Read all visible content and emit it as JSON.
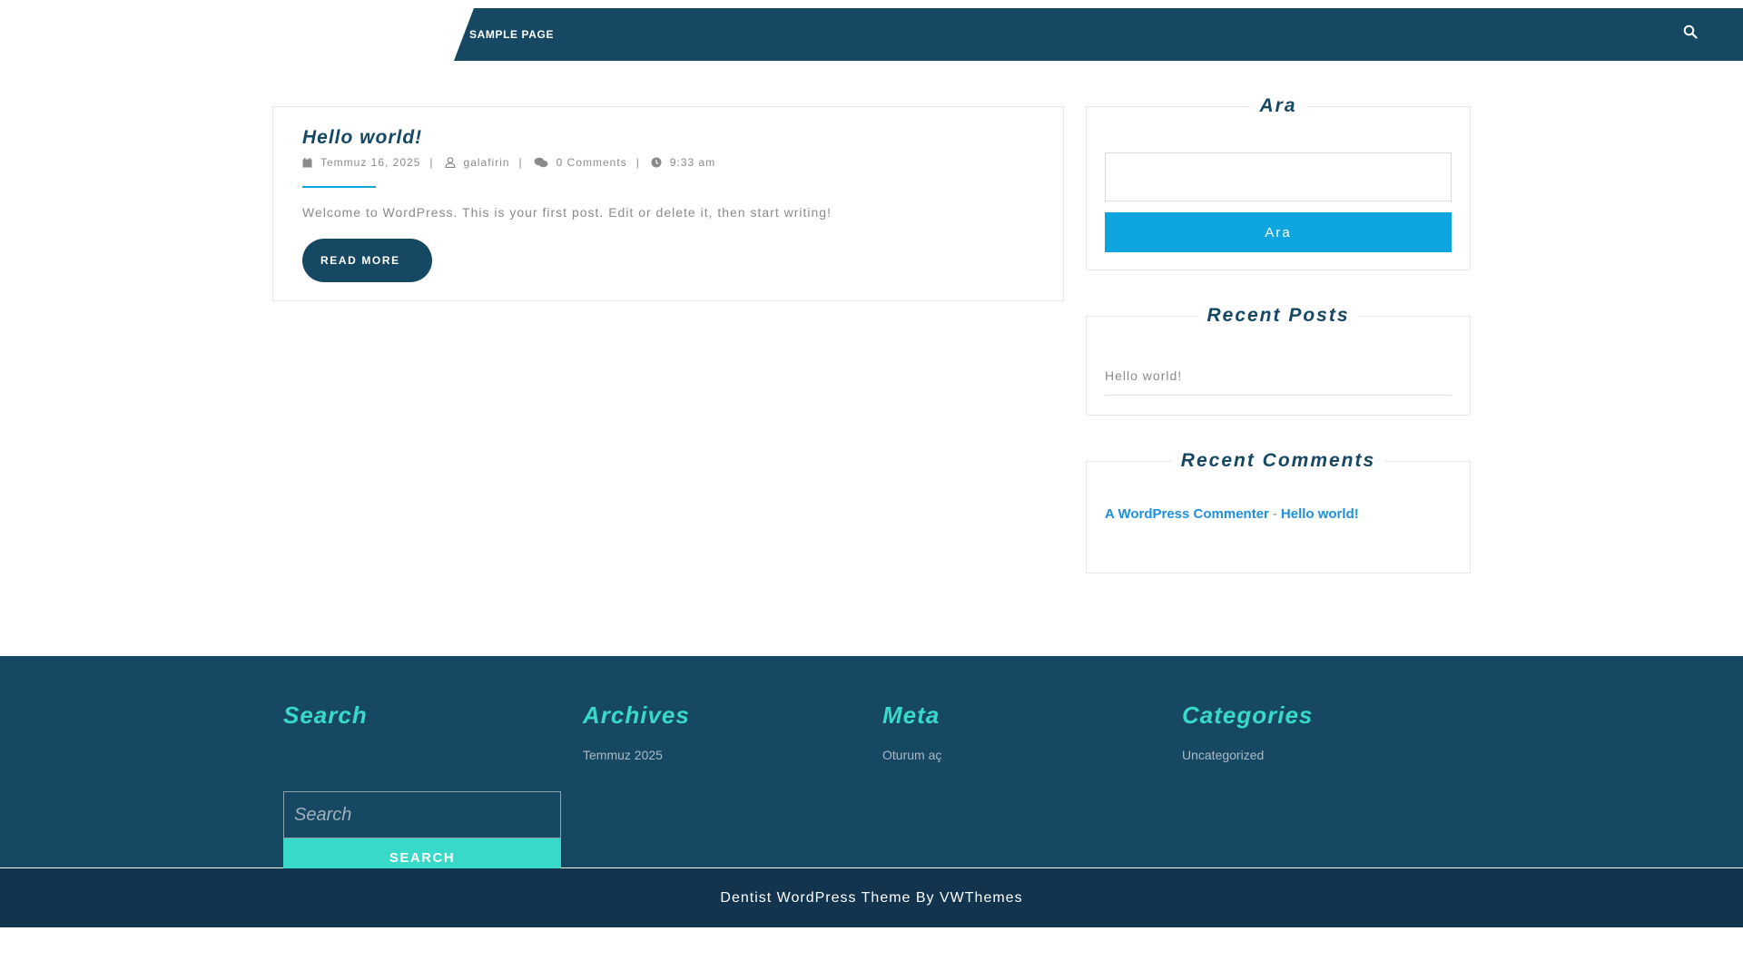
{
  "nav": {
    "items": [
      "SAMPLE PAGE"
    ],
    "search_icon": "search-icon"
  },
  "post": {
    "title": "Hello world!",
    "date": "Temmuz 16, 2025",
    "author": "galafirin",
    "comments": "0 Comments",
    "time": "9:33 am",
    "separator": "|",
    "excerpt": "Welcome to WordPress. This is your first post. Edit or delete it, then start writing!",
    "read_more": "READ MORE"
  },
  "sidebar": {
    "ara": {
      "title": "Ara",
      "button": "Ara",
      "value": ""
    },
    "recent_posts": {
      "title": "Recent Posts",
      "items": [
        "Hello world!"
      ]
    },
    "recent_comments": {
      "title": "Recent Comments",
      "author": "A WordPress Commenter",
      "dash": "-",
      "post": "Hello world!"
    }
  },
  "footer": {
    "search": {
      "title": "Search",
      "placeholder": "Search",
      "button": "SEARCH"
    },
    "archives": {
      "title": "Archives",
      "items": [
        "Temmuz 2025"
      ]
    },
    "meta": {
      "title": "Meta",
      "items": [
        "Oturum aç"
      ]
    },
    "categories": {
      "title": "Categories",
      "items": [
        "Uncategorized"
      ]
    },
    "copyright": "Dentist WordPress Theme By VWThemes"
  },
  "colors": {
    "primary": "#164863",
    "accent": "#0ea5e0",
    "teal": "#38d9c8",
    "link": "#1e90e0",
    "footer_bottom": "#12344e"
  }
}
